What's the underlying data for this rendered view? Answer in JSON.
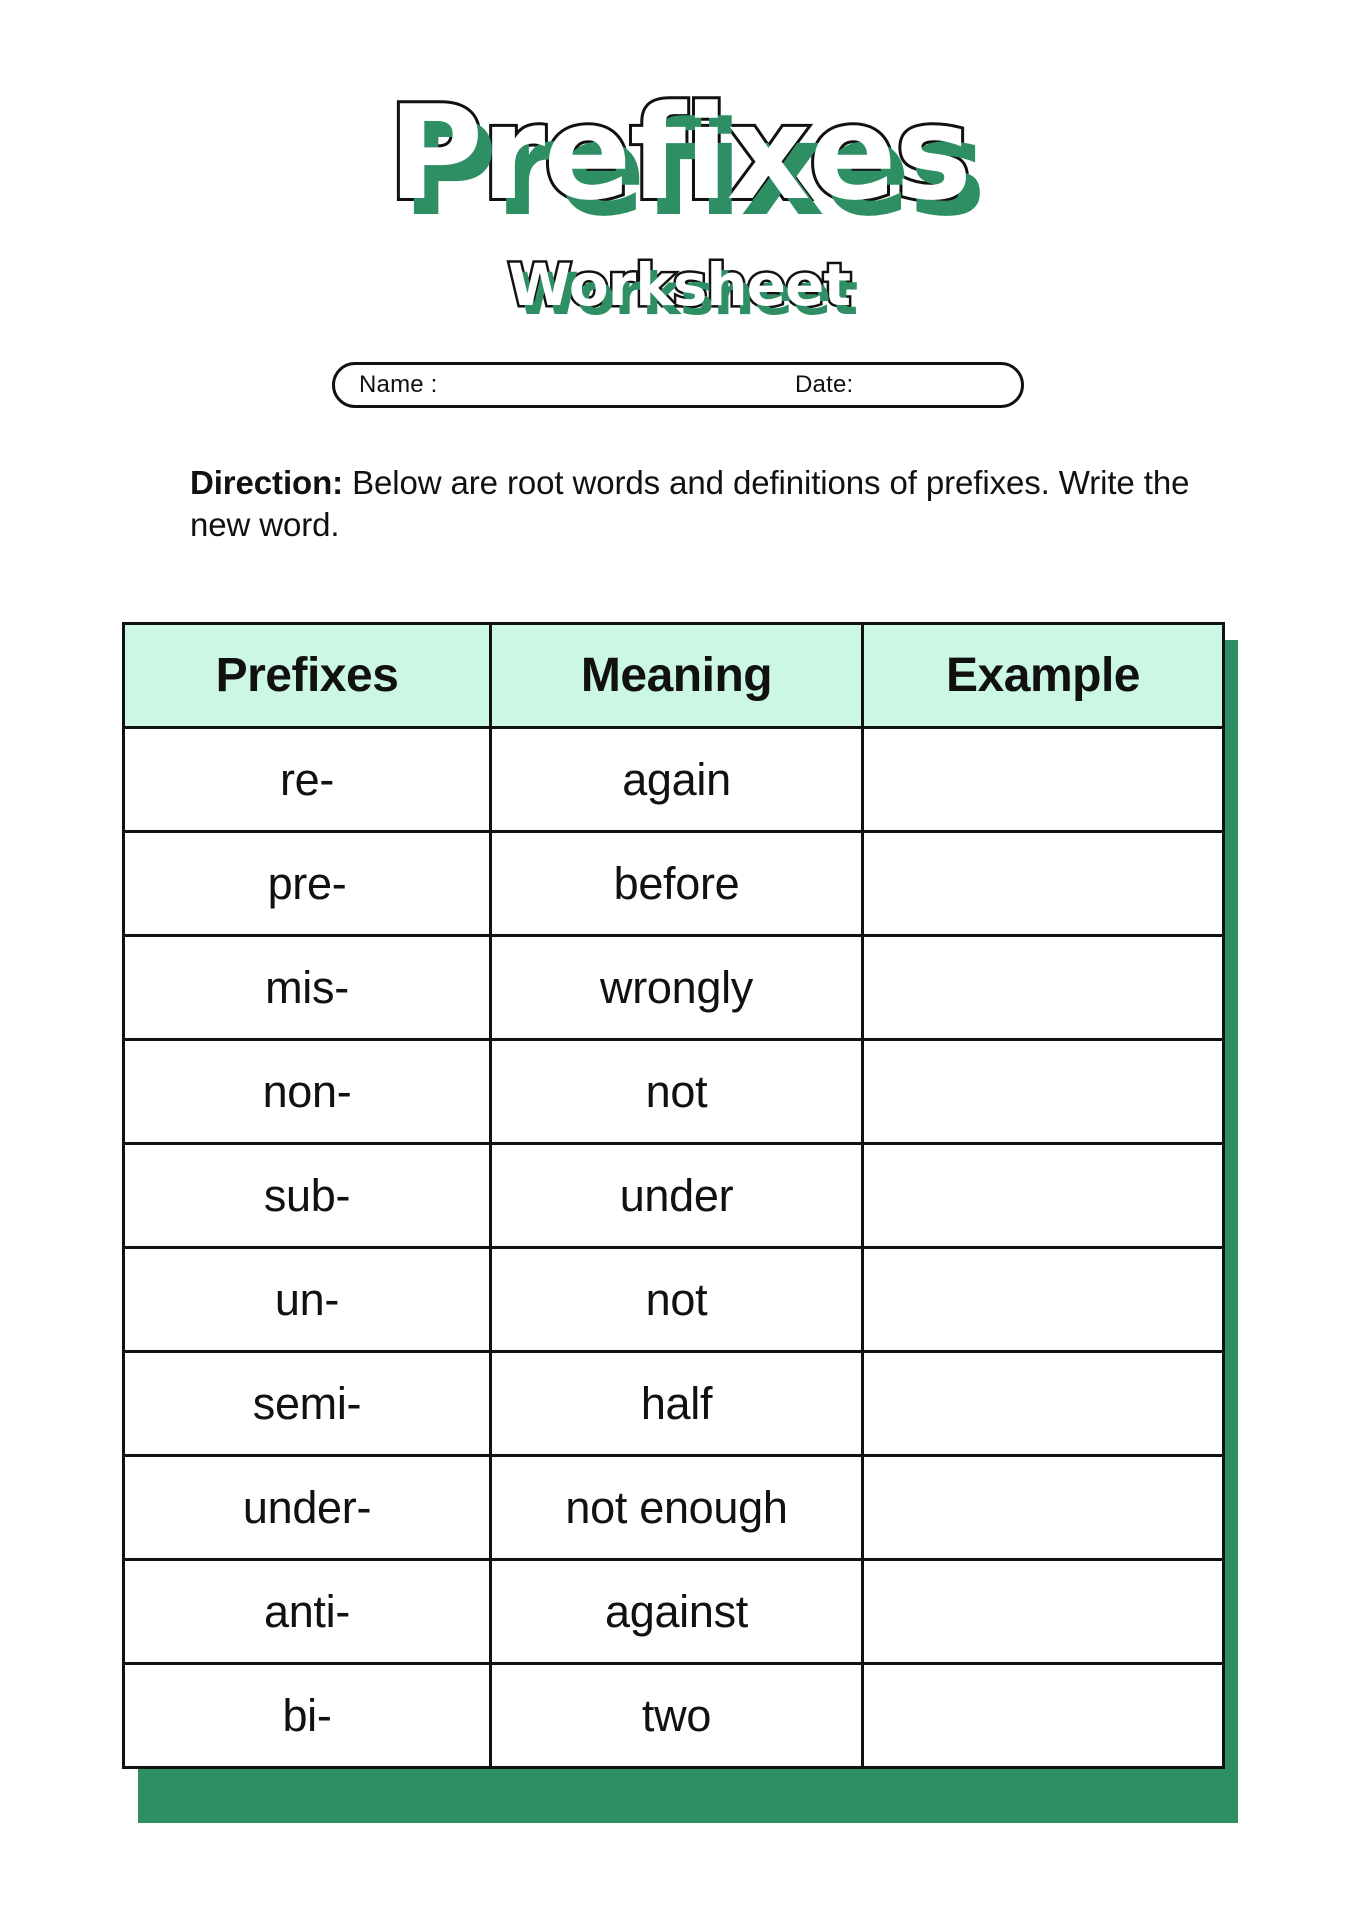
{
  "header": {
    "title": "Prefixes",
    "subtitle": "Worksheet",
    "accent_green": "#2f8f64",
    "header_mint": "#ccf7e3",
    "outline_black": "#111111"
  },
  "name_date": {
    "name_label": "Name :",
    "date_label": "Date:"
  },
  "direction": {
    "bold_label": "Direction:",
    "text": " Below are root words and definitions of prefixes. Write the new word."
  },
  "table": {
    "columns": [
      "Prefixes",
      "Meaning",
      "Example"
    ],
    "rows": [
      {
        "prefix": "re-",
        "meaning": "again",
        "example": ""
      },
      {
        "prefix": "pre-",
        "meaning": "before",
        "example": ""
      },
      {
        "prefix": "mis-",
        "meaning": "wrongly",
        "example": ""
      },
      {
        "prefix": "non-",
        "meaning": "not",
        "example": ""
      },
      {
        "prefix": "sub-",
        "meaning": "under",
        "example": ""
      },
      {
        "prefix": "un-",
        "meaning": "not",
        "example": ""
      },
      {
        "prefix": "semi-",
        "meaning": "half",
        "example": ""
      },
      {
        "prefix": "under-",
        "meaning": "not enough",
        "example": ""
      },
      {
        "prefix": "anti-",
        "meaning": "against",
        "example": ""
      },
      {
        "prefix": "bi-",
        "meaning": "two",
        "example": ""
      }
    ]
  }
}
